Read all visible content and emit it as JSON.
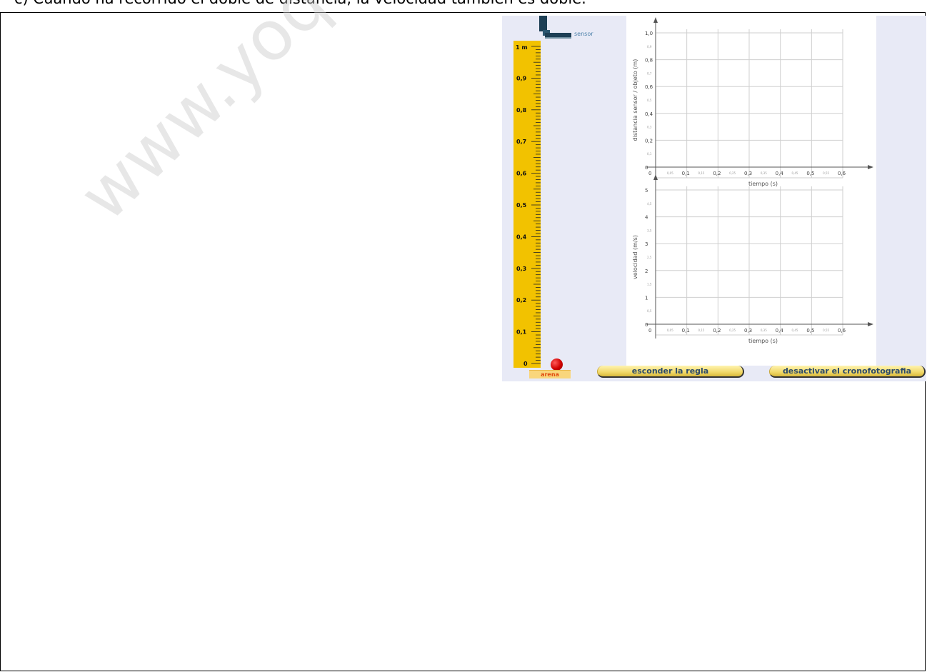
{
  "header": {
    "text": "c) Cuando ha recorrido el doble de distancia, la velocidad también es doble."
  },
  "watermark": {
    "text": "www.yoquiero"
  },
  "sensor": {
    "label": "sensor"
  },
  "ruler": {
    "top_label": "1 m",
    "labels": [
      "0,9",
      "0,8",
      "0,7",
      "0,6",
      "0,5",
      "0,4",
      "0,3",
      "0,2",
      "0,1",
      "0"
    ]
  },
  "arena": {
    "label": "arena"
  },
  "graph_position": {
    "ylabel": "distancia sensor / objeto (m)",
    "xlabel": "tiempo (s)",
    "y_ticks": [
      "1,0",
      "0,8",
      "0,6",
      "0,4",
      "0,2",
      "0"
    ],
    "y_minor": [
      "0,9",
      "0,7",
      "0,5",
      "0,3",
      "0,1"
    ],
    "x_ticks": [
      "0,1",
      "0,2",
      "0,3",
      "0,4",
      "0,5",
      "0,6"
    ],
    "x_minor": [
      "0,05",
      "0,15",
      "0,25",
      "0,35",
      "0,45",
      "0,55"
    ]
  },
  "graph_velocity": {
    "ylabel": "velocidad (m/s)",
    "xlabel": "tiempo (s)",
    "y_ticks": [
      "5",
      "4",
      "3",
      "2",
      "1",
      "0"
    ],
    "y_minor": [
      "4,5",
      "3,5",
      "2,5",
      "1,5",
      "0,5"
    ],
    "x_ticks": [
      "0,1",
      "0,2",
      "0,3",
      "0,4",
      "0,5",
      "0,6"
    ],
    "x_minor": [
      "0,05",
      "0,15",
      "0,25",
      "0,35",
      "0,45",
      "0,55"
    ]
  },
  "buttons": {
    "hide_ruler": "esconder la regla",
    "chronophoto": "desactivar el cronofotografia"
  },
  "colors": {
    "ruler": "#f2c200",
    "sensor": "#1d3f55",
    "ball": "#d00000",
    "panel": "#e8eaf6"
  }
}
